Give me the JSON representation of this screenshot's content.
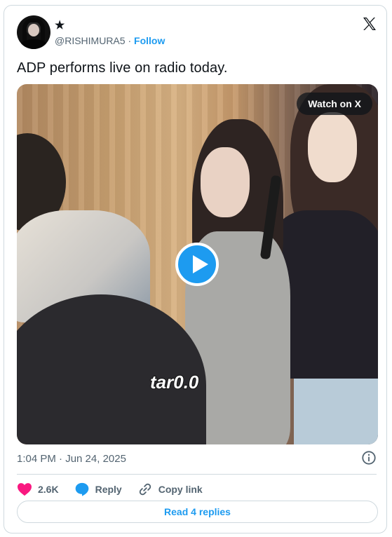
{
  "tweet": {
    "display_name": "★",
    "handle": "@RISHIMURA5",
    "separator": "·",
    "follow_label": "Follow",
    "text": "ADP performs live on radio today.",
    "watch_label": "Watch on X",
    "watermark": "tar0.0",
    "timestamp": "1:04 PM · Jun 24, 2025",
    "likes": "2.6K",
    "reply_label": "Reply",
    "copy_link_label": "Copy link",
    "read_replies_label": "Read 4 replies"
  },
  "icons": {
    "brand": "x-logo-icon",
    "info": "info-icon",
    "like": "heart-icon",
    "reply": "speech-bubble-icon",
    "copy": "link-icon",
    "play": "play-icon"
  },
  "colors": {
    "accent": "#1d9bf0",
    "like": "#f91880",
    "text": "#0f1419",
    "muted": "#536471",
    "border": "#cfd9de"
  }
}
